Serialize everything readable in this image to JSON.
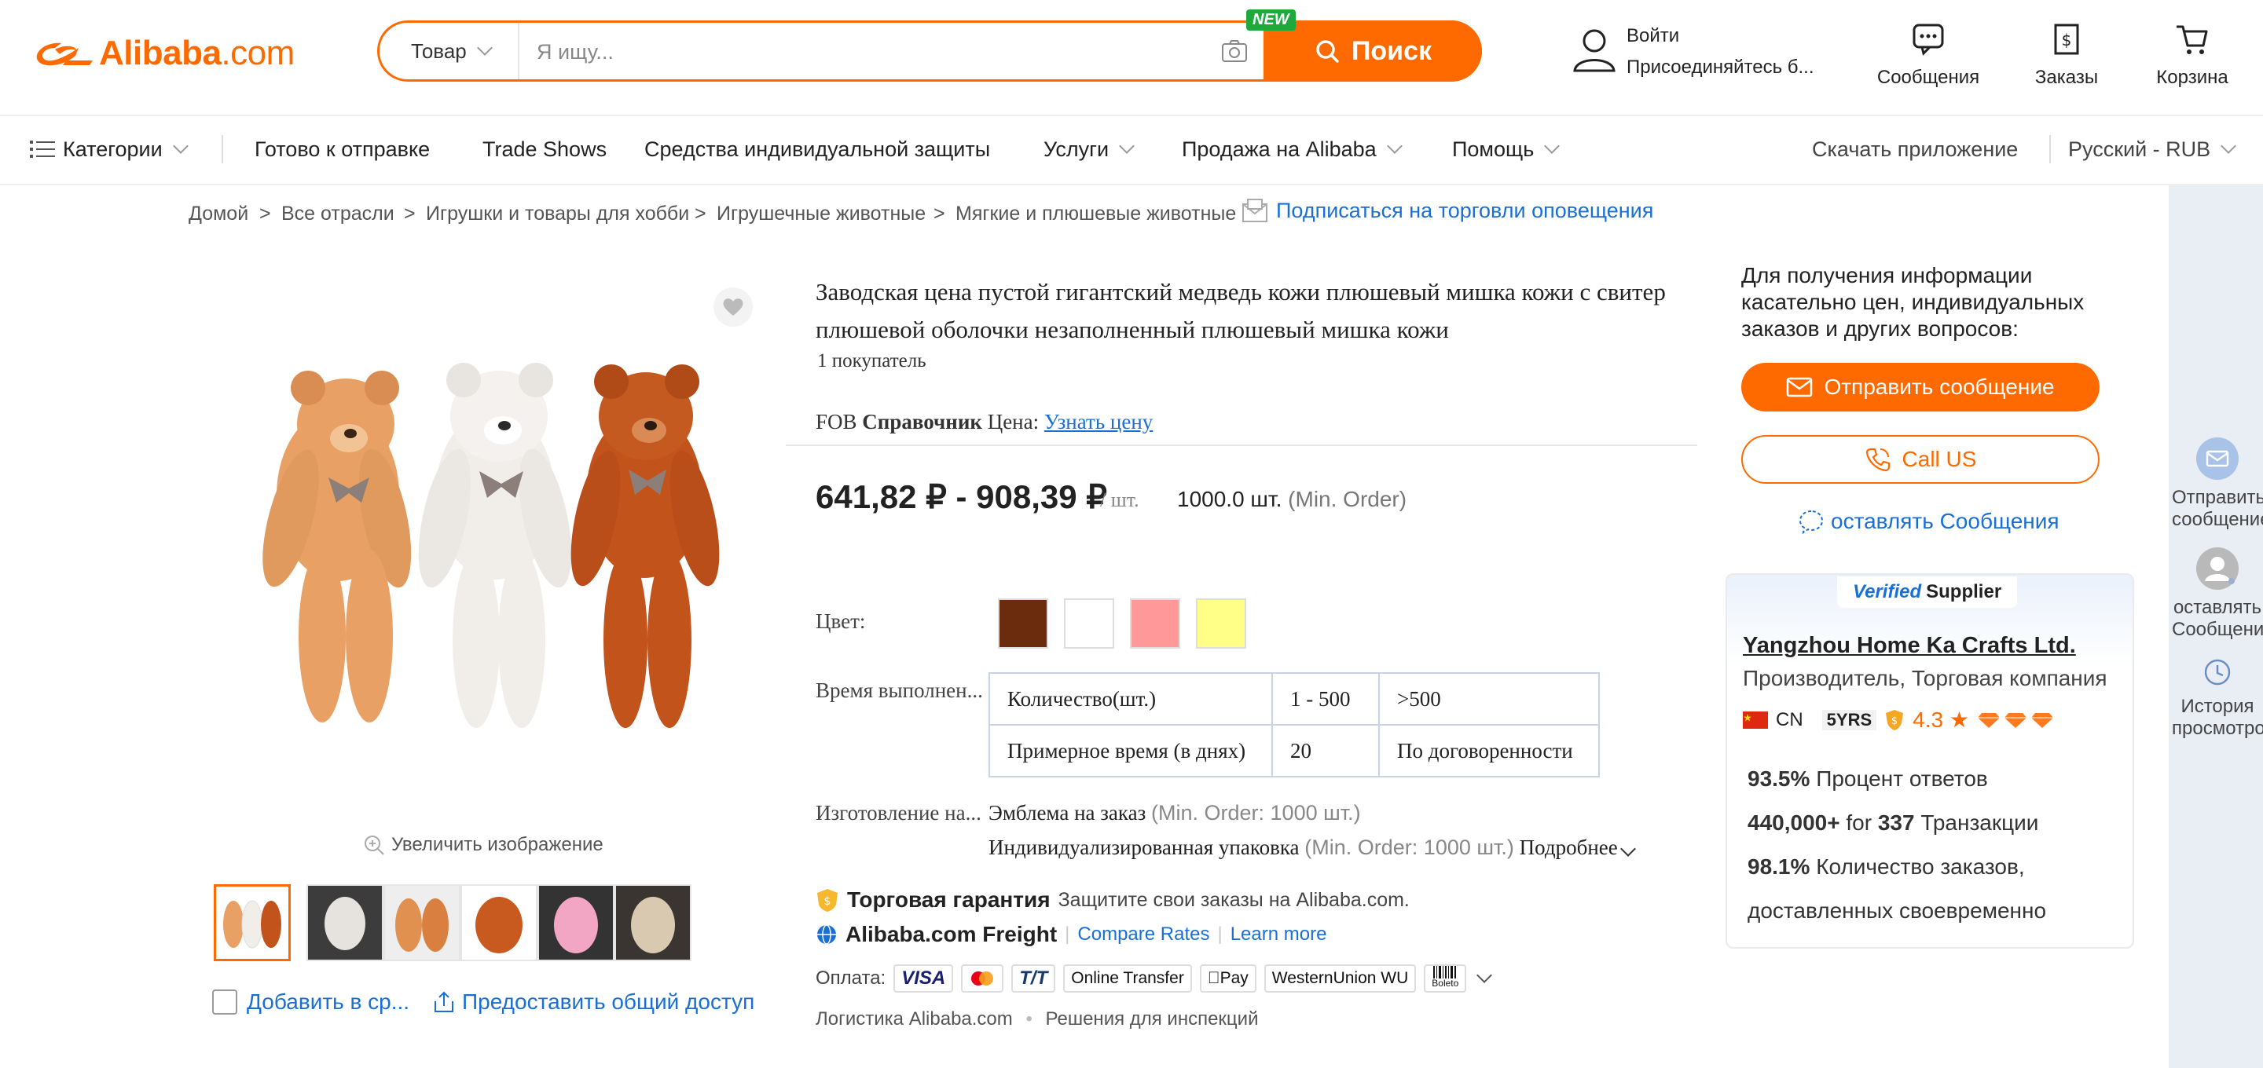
{
  "header": {
    "logo_main": "Alibaba",
    "logo_com": ".com",
    "search_category": "Товар",
    "search_placeholder": "Я ищу...",
    "new_badge": "NEW",
    "search_button": "Поиск",
    "signin_line1": "Войти",
    "signin_line2": "Присоединяйтесь б...",
    "messages": "Сообщения",
    "orders": "Заказы",
    "cart": "Корзина"
  },
  "nav": {
    "categories": "Категории",
    "items": [
      "Готово к отправке",
      "Trade Shows",
      "Средства индивидуальной защиты",
      "Услуги",
      "Продажа на Alibaba",
      "Помощь"
    ],
    "download_app": "Скачать приложение",
    "language": "Русский - RUB"
  },
  "breadcrumb": {
    "items": [
      "Домой",
      "Все отрасли",
      "Игрушки и товары для хобби",
      "Игрушечные животные",
      "Мягкие и плюшевые животные"
    ],
    "separator": ">",
    "subscribe": "Подписаться на торговли оповещения"
  },
  "gallery": {
    "zoom_label": "Увеличить изображение",
    "compare_label": "Добавить в ср...",
    "share_label": "Предоставить общий доступ"
  },
  "product": {
    "title": "Заводская цена пустой гигантский медведь кожи плюшевый мишка кожи с свитер плюшевой оболочки незаполненный плюшевый мишка кожи",
    "buyers": "1 покупатель",
    "fob_prefix": "FOB",
    "fob_bold": "Справочник",
    "fob_suffix": "Цена:",
    "fob_link": "Узнать цену",
    "price": "641,82 ₽ - 908,39 ₽",
    "price_unit": "/ шт.",
    "moq_value": "1000.0 шт.",
    "moq_label": "(Min. Order)",
    "color_label": "Цвет:",
    "colors": [
      "#6b2b0d",
      "#ffffff",
      "#ff9999",
      "#ffff88"
    ],
    "lead_time_label": "Время выполнен...",
    "lead_table": {
      "row1": [
        "Количество(шт.)",
        "1 - 500",
        ">500"
      ],
      "row2": [
        "Примерное время (в днях)",
        "20",
        "По договоренности"
      ]
    },
    "custom_label": "Изготовление на...",
    "custom1": "Эмблема на заказ",
    "custom1_moq": "(Min. Order: 1000 шт.)",
    "custom2": "Индивидуализированная упаковка",
    "custom2_moq": "(Min. Order: 1000 шт.)",
    "more": "Подробнее",
    "trade_assurance": "Торговая гарантия",
    "trade_assurance_desc": "Защитите свои заказы на Alibaba.com.",
    "freight": "Alibaba.com Freight",
    "compare_rates": "Compare Rates",
    "learn_more": "Learn more",
    "payment_label": "Оплата:",
    "payment_methods": [
      "VISA",
      "",
      "T/T",
      "Online Transfer",
      "Pay",
      "WesternUnion WU",
      "Boleto"
    ],
    "logistics": "Логистика Alibaba.com",
    "inspection": "Решения для инспекций"
  },
  "contact": {
    "ask_text": "Для получения информации касательно цен, индивидуальных заказов и других вопросов:",
    "send_message": "Отправить сообщение",
    "call_us": "Call US",
    "leave_message": "оставлять Сообщения"
  },
  "supplier": {
    "verified": "Verified",
    "supplier_word": "Supplier",
    "name": "Yangzhou Home Ka Crafts Ltd.",
    "type": "Производитель, Торговая компания",
    "country": "CN",
    "years": "5YRS",
    "rating": "4.3",
    "response_rate": "93.5%",
    "response_label": "Процент ответов",
    "transactions_amount": "440,000+",
    "transactions_for": "for",
    "transactions_count": "337",
    "transactions_label": "Транзакции",
    "on_time_rate": "98.1%",
    "on_time_label": "Количество заказов,",
    "on_time_label2": "доставленных своевременно"
  },
  "sidebar": {
    "item1_l1": "Отправить",
    "item1_l2": "сообщение",
    "item2_l1": "оставлять",
    "item2_l2": "Сообщения",
    "item3_l1": "История",
    "item3_l2": "просмотров"
  }
}
